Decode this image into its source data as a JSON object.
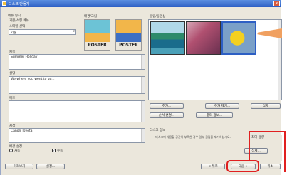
{
  "window": {
    "title": "디스크 만들기"
  },
  "left": {
    "menu_label": "메뉴 형식",
    "menu_value": "기본/소형 메뉴",
    "style_label": "스타일 선택",
    "style_value": "기본",
    "title_label": "제목",
    "title_value": "Summer Holiday",
    "desc_label": "설명",
    "desc_value": "We where you went to go...",
    "memo_label": "메모",
    "credit_label": "제작",
    "credit_value": "Canon Toyota",
    "opt_label": "배경 설정",
    "opt_a": "자동",
    "opt_b": "수동"
  },
  "center": {
    "bg_label": "배경/그림",
    "poster1": "POSTER",
    "poster2": "POSTER"
  },
  "right": {
    "clips_label": "클립/동영상",
    "btn_add": "추가...",
    "btn_remove": "추가 제거...",
    "btn_delete": "삭제",
    "btn_order": "순서 변경...",
    "btn_chapter": "챕터 정보...",
    "disc_label": "디스크 정보",
    "disc_text": "디스크에 사용할 공간이 부족한 경우 일부 클립을 제거하십시오.",
    "size_label": "최대 용량",
    "size_button": "상세..."
  },
  "footer": {
    "btn_preview": "미리보기",
    "btn_settings": "설정...",
    "btn_back": "< 뒤로",
    "btn_next": "다음 >",
    "btn_cancel": "취소"
  },
  "colors": {
    "accent": "#2d5fc4",
    "highlight": "#e02020",
    "poster1_top": "#6cc3d6",
    "poster1_bottom": "#f2b64a",
    "poster2_top": "#f2b64a",
    "poster2_bottom": "#3d6fc4"
  }
}
